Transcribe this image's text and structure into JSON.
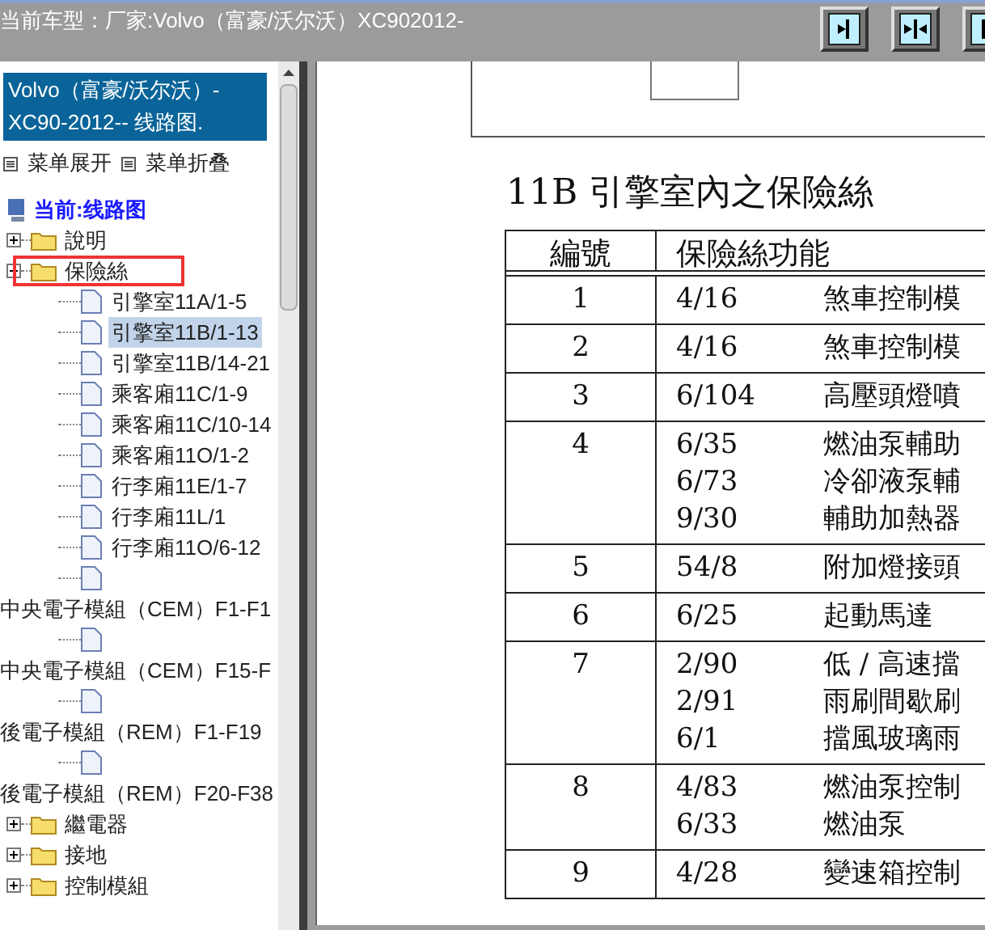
{
  "header": {
    "title": "当前车型：厂家:Volvo（富豪/沃尔沃）XC902012-"
  },
  "sidebar": {
    "title": "Volvo（富豪/沃尔沃）-XC90-2012-- 线路图.",
    "menu_links": [
      "菜单展开",
      "菜单折叠"
    ],
    "tree": {
      "label": "当前:线路图",
      "children": [
        {
          "label": "說明",
          "kind": "folder",
          "expanded": false,
          "selected": false,
          "highlighted": false
        },
        {
          "label": "保險絲",
          "kind": "folder",
          "expanded": true,
          "selected": false,
          "highlighted": true,
          "children": [
            {
              "label": "引擎室11A/1-5",
              "kind": "page",
              "selected": false
            },
            {
              "label": "引擎室11B/1-13",
              "kind": "page",
              "selected": true
            },
            {
              "label": "引擎室11B/14-21",
              "kind": "page",
              "selected": false
            },
            {
              "label": "乘客廂11C/1-9",
              "kind": "page",
              "selected": false
            },
            {
              "label": "乘客廂11C/10-14",
              "kind": "page",
              "selected": false
            },
            {
              "label": "乘客廂11O/1-2",
              "kind": "page",
              "selected": false
            },
            {
              "label": "行李廂11E/1-7",
              "kind": "page",
              "selected": false
            },
            {
              "label": "行李廂11L/1",
              "kind": "page",
              "selected": false
            },
            {
              "label": "行李廂11O/6-12",
              "kind": "page",
              "selected": false
            },
            {
              "label": "中央電子模組（CEM）F1-F1",
              "kind": "wrapped",
              "selected": false
            },
            {
              "label": "中央電子模組（CEM）F15-F",
              "kind": "wrapped",
              "selected": false
            },
            {
              "label": "後電子模組（REM）F1-F19",
              "kind": "wrapped",
              "selected": false
            },
            {
              "label": "後電子模組（REM）F20-F38",
              "kind": "wrapped",
              "selected": false
            }
          ]
        },
        {
          "label": "繼電器",
          "kind": "folder",
          "expanded": false,
          "selected": false,
          "highlighted": false
        },
        {
          "label": "接地",
          "kind": "folder",
          "expanded": false,
          "selected": false,
          "highlighted": false
        },
        {
          "label": "控制模組",
          "kind": "folder",
          "expanded": false,
          "selected": false,
          "highlighted": false
        }
      ]
    }
  },
  "document": {
    "title": "11B 引擎室內之保險絲",
    "columns": [
      "編號",
      "保險絲功能"
    ],
    "rows": [
      {
        "number": "1",
        "entries": [
          {
            "code": "4/16",
            "function": "煞車控制模"
          }
        ]
      },
      {
        "number": "2",
        "entries": [
          {
            "code": "4/16",
            "function": "煞車控制模"
          }
        ]
      },
      {
        "number": "3",
        "entries": [
          {
            "code": "6/104",
            "function": "高壓頭燈噴"
          }
        ]
      },
      {
        "number": "4",
        "entries": [
          {
            "code": "6/35",
            "function": "燃油泵輔助"
          },
          {
            "code": "6/73",
            "function": "冷卻液泵輔"
          },
          {
            "code": "9/30",
            "function": "輔助加熱器"
          }
        ]
      },
      {
        "number": "5",
        "entries": [
          {
            "code": "54/8",
            "function": "附加燈接頭"
          }
        ]
      },
      {
        "number": "6",
        "entries": [
          {
            "code": "6/25",
            "function": "起動馬達"
          }
        ]
      },
      {
        "number": "7",
        "entries": [
          {
            "code": "2/90",
            "function": "低 / 高速擋"
          },
          {
            "code": "2/91",
            "function": "雨刷間歇刷"
          },
          {
            "code": "6/1",
            "function": "擋風玻璃雨"
          }
        ]
      },
      {
        "number": "8",
        "entries": [
          {
            "code": "4/83",
            "function": "燃油泵控制"
          },
          {
            "code": "6/33",
            "function": "燃油泵"
          }
        ]
      },
      {
        "number": "9",
        "entries": [
          {
            "code": "4/28",
            "function": "變速箱控制"
          }
        ]
      }
    ]
  }
}
